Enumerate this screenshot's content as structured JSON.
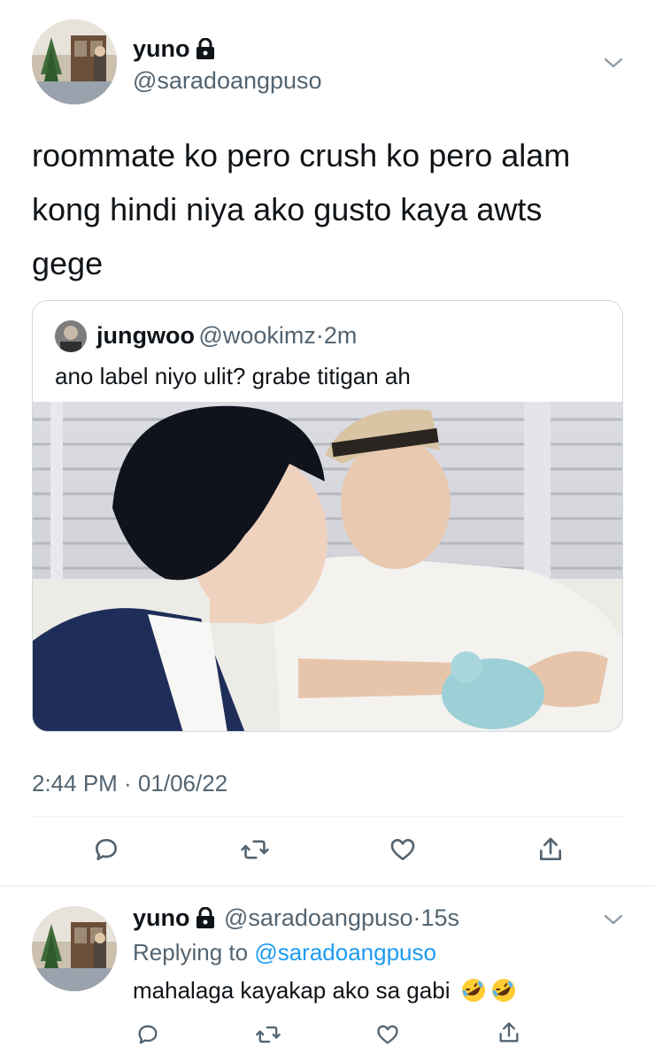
{
  "main_tweet": {
    "author_name": "yuno",
    "author_handle": "@saradoangpuso",
    "text_lines": [
      "roommate ko pero crush ko pero alam",
      "kong hindi niya ako gusto kaya awts",
      "gege"
    ],
    "timestamp": "2:44 PM · 01/06/22"
  },
  "quote": {
    "author_name": "jungwoo",
    "author_handle": "@wookimz",
    "time": "2m",
    "separator": "·",
    "text": "ano label niyo ulit? grabe titigan ah"
  },
  "reply": {
    "author_name": "yuno",
    "author_handle": "@saradoangpuso",
    "separator": "·",
    "time": "15s",
    "replying_prefix": "Replying to ",
    "replying_mention": "@saradoangpuso",
    "text": "mahalaga kayakap ako sa gabi",
    "emojis": [
      "rolling-on-floor-laughing",
      "rolling-on-floor-laughing"
    ]
  },
  "icons": {
    "reply": "reply-icon",
    "retweet": "retweet-icon",
    "like": "like-icon",
    "share": "share-icon",
    "lock": "lock-icon",
    "more": "chevron-down-icon"
  },
  "colors": {
    "text": "#0f1419",
    "secondary": "#536471",
    "accent": "#1d9bf0",
    "border": "#cfd9de"
  }
}
